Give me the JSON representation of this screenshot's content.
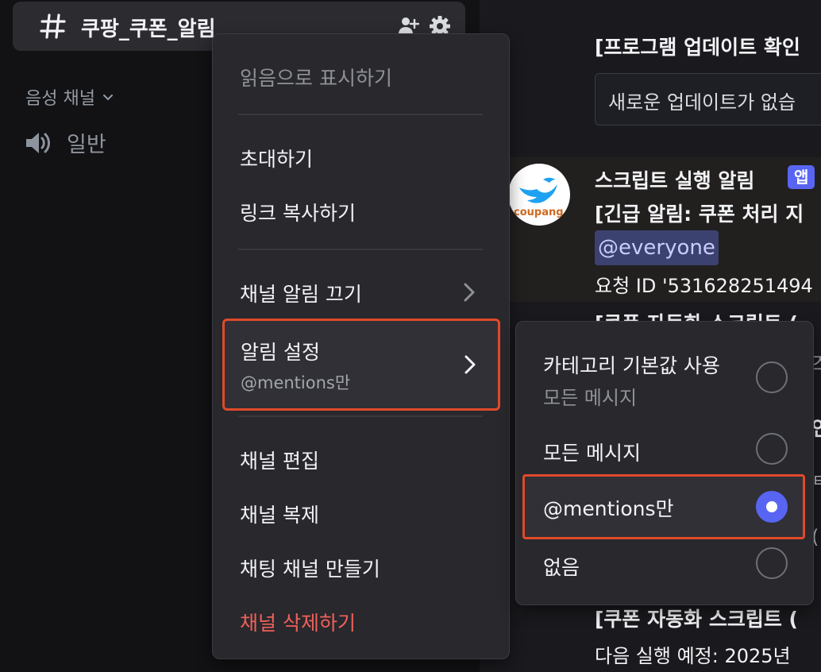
{
  "sidebar": {
    "channel_name": "쿠팡_쿠폰_알림",
    "voice_category": "음성 채널",
    "voice_channel": "일반"
  },
  "chat": {
    "line1": "[프로그램 업데이트 확인",
    "update_box_text": "새로운  업데이트가  없습",
    "bot_name": "스크립트 실행 알림",
    "bot_badge": "앱",
    "avatar_text": "coupang",
    "alert_line": "[긴급 알림: 쿠폰 처리 지",
    "mention": "@everyone",
    "request_line": "요청 ID '531628251494",
    "partial_line": "[쿠폰 자동화 스크립트 (",
    "side_char1": "즈",
    "side_char2": "인",
    "side_char3": "ㅌ",
    "side_char4": "(",
    "footer_title": "[쿠폰 자동화 스크립트 (",
    "footer_line": "다음 실행 예정: 2025년"
  },
  "menu": {
    "mark_read": "읽음으로 표시하기",
    "invite": "초대하기",
    "copy_link": "링크 복사하기",
    "mute_channel": "채널 알림 끄기",
    "notif_settings": "알림 설정",
    "notif_settings_value": "@mentions만",
    "edit_channel": "채널 편집",
    "duplicate_channel": "채널 복제",
    "create_text_channel": "채팅 채널 만들기",
    "delete_channel": "채널 삭제하기"
  },
  "submenu": {
    "options": [
      {
        "label": "카테고리 기본값 사용",
        "sub": "모든 메시지",
        "checked": false
      },
      {
        "label": "모든 메시지",
        "checked": false
      },
      {
        "label": "@mentions만",
        "checked": true
      },
      {
        "label": "없음",
        "checked": false
      }
    ]
  },
  "colors": {
    "accent": "#5865f2",
    "highlight_border": "#e04a2a",
    "danger": "#f0605a"
  }
}
